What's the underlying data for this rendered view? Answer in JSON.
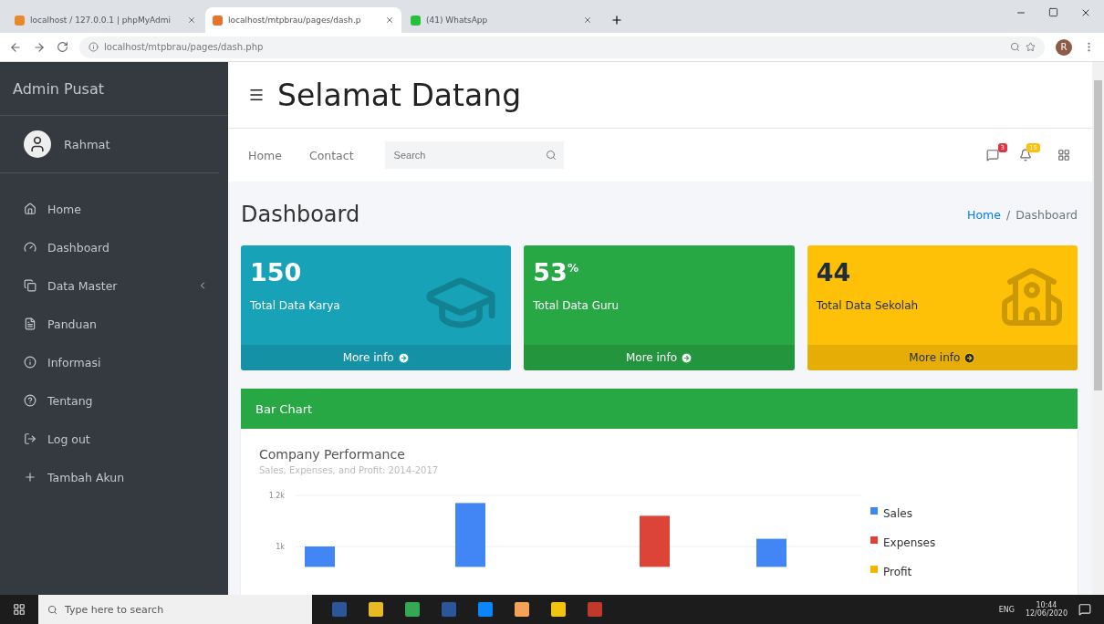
{
  "browser": {
    "tabs": [
      {
        "title": "localhost / 127.0.0.1 | phpMyAdmi",
        "selected": false,
        "color": "#e8892b"
      },
      {
        "title": "localhost/mtpbrau/pages/dash.p",
        "selected": true,
        "color": "#e8732b"
      },
      {
        "title": "(41) WhatsApp",
        "selected": false,
        "color": "#25c13a"
      }
    ],
    "url": "localhost/mtpbrau/pages/dash.php",
    "avatar": "R"
  },
  "sidebar": {
    "brand": "Admin Pusat",
    "user": "Rahmat",
    "items": [
      {
        "label": "Home",
        "kind": "home",
        "submenu": false
      },
      {
        "label": "Dashboard",
        "kind": "gauge",
        "submenu": false
      },
      {
        "label": "Data Master",
        "kind": "copy",
        "submenu": true
      },
      {
        "label": "Panduan",
        "kind": "file",
        "submenu": false
      },
      {
        "label": "Informasi",
        "kind": "info",
        "submenu": false
      },
      {
        "label": "Tentang",
        "kind": "help",
        "submenu": false
      },
      {
        "label": "Log out",
        "kind": "logout",
        "submenu": false
      },
      {
        "label": "Tambah Akun",
        "kind": "plus",
        "submenu": false
      }
    ]
  },
  "header": {
    "title": "Selamat Datang"
  },
  "navbar": {
    "links": [
      "Home",
      "Contact"
    ],
    "search": {
      "placeholder": "Search"
    },
    "badges": [
      {
        "kind": "message",
        "count": "3",
        "color": "#dc3545"
      },
      {
        "kind": "bell",
        "count": "15",
        "color": "#ffc107"
      }
    ]
  },
  "page": {
    "title": "Dashboard",
    "breadcrumb": [
      "Home",
      "/",
      "Dashboard"
    ]
  },
  "stats": [
    {
      "value": "150",
      "label": "Total Data Karya",
      "link": "More info",
      "color": "#17a2b8",
      "kind": "cap"
    },
    {
      "value": "53$^{%}$",
      "label": "Total Data Guru",
      "link": "More info",
      "color": "#28a745",
      "kind": "plain"
    },
    {
      "value": "44",
      "label": "Total Data Sekolah",
      "link": "More info",
      "color": "#ffc107",
      "kind": "school"
    }
  ],
  "chart_card": {
    "header": "Bar Chart",
    "subtitle": "Sales, Expenses, and Profit: 2014-2017",
    "chart_data": {
      "type": "bar",
      "title": "Company Performance",
      "stacked": false,
      "series": [
        {
          "name": "Sales",
          "color": "#4285f4",
          "values": [
            1000,
            1170,
            null,
            1030
          ]
        },
        {
          "name": "Expenses",
          "color": "#db4437",
          "values": [
            null,
            null,
            1120,
            null
          ]
        },
        {
          "name": "Profit",
          "color": "#f4b400",
          "values": [
            null,
            null,
            null,
            null
          ]
        }
      ],
      "ylim": [
        920,
        1200
      ],
      "yticks": [
        {
          "value": 1000,
          "label": "1k"
        },
        {
          "value": 1200,
          "label": "1.2k"
        }
      ]
    }
  },
  "taskbar": {
    "search": {
      "placeholder": "Type here to search"
    },
    "apps": [
      {
        "color": "#2b579a"
      },
      {
        "color": "#e8b923"
      },
      {
        "color": "#34a853"
      },
      {
        "color": "#2b579a"
      },
      {
        "color": "#0a84ff"
      },
      {
        "color": "#f4a259"
      },
      {
        "color": "#f1c40f"
      },
      {
        "color": "#c0392b"
      }
    ],
    "lang": "ENG",
    "time": "10:44",
    "date": "12/06/2020"
  }
}
